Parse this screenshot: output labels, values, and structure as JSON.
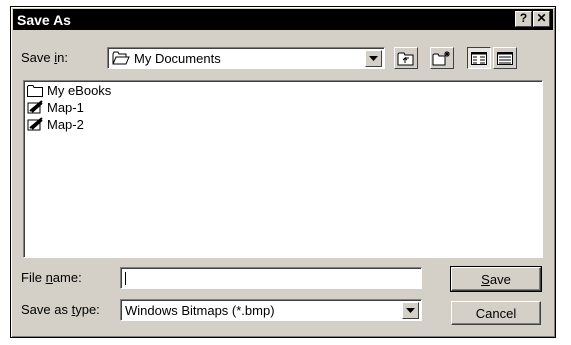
{
  "window": {
    "title": "Save As",
    "help_glyph": "?",
    "close_glyph": "✕"
  },
  "save_in": {
    "label_pre": "Save ",
    "label_accel": "i",
    "label_post": "n:",
    "value": "My Documents",
    "icon": "open-folder-icon"
  },
  "toolbar": [
    {
      "name": "up-one-level-button",
      "icon": "folder-up-icon"
    },
    {
      "name": "new-folder-button",
      "icon": "new-folder-icon"
    },
    {
      "name": "list-view-button",
      "icon": "list-view-icon",
      "pressed": true
    },
    {
      "name": "details-view-button",
      "icon": "details-view-icon"
    }
  ],
  "files": [
    {
      "name": "My eBooks",
      "icon": "folder-icon"
    },
    {
      "name": "Map-1",
      "icon": "paint-file-icon"
    },
    {
      "name": "Map-2",
      "icon": "paint-file-icon"
    }
  ],
  "file_name": {
    "label_pre": "File ",
    "label_accel": "n",
    "label_post": "ame:",
    "value": "",
    "placeholder": ""
  },
  "save_type": {
    "label_pre": "Save as ",
    "label_accel": "t",
    "label_post": "ype:",
    "value": "Windows Bitmaps (*.bmp)"
  },
  "buttons": {
    "save_accel": "S",
    "save_rest": "ave",
    "cancel": "Cancel"
  }
}
